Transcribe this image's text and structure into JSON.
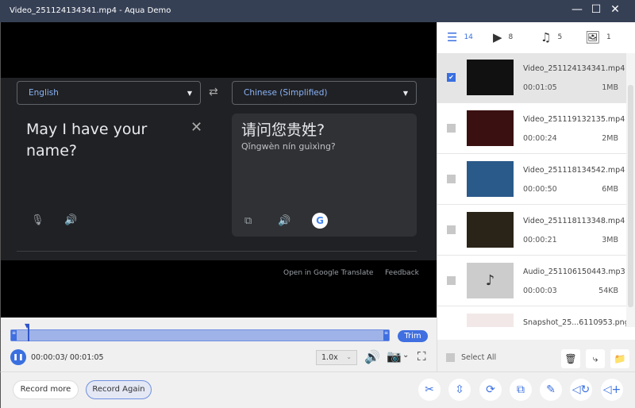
{
  "window": {
    "title": "Video_251124134341.mp4  -  Aqua Demo",
    "minimize": "—",
    "maximize": "☐",
    "close": "✕"
  },
  "translate": {
    "source_lang": "English",
    "target_lang": "Chinese (Simplified)",
    "source_text": "May I have your name?",
    "target_text": "请问您贵姓?",
    "romanization": "Qǐngwèn nín guìxìng?",
    "open_link": "Open in Google Translate",
    "feedback": "Feedback"
  },
  "player": {
    "trim": "Trim",
    "time": "00:00:03/ 00:01:05",
    "speed": "1.0x",
    "progress": 0.046
  },
  "buttons": {
    "record_more": "Record more",
    "record_again": "Record Again"
  },
  "tabs": [
    {
      "icon": "list-icon",
      "count": "14"
    },
    {
      "icon": "video-icon",
      "count": "8"
    },
    {
      "icon": "music-icon",
      "count": "5"
    },
    {
      "icon": "image-icon",
      "count": "1"
    }
  ],
  "files": [
    {
      "name": "Video_251124134341.mp4",
      "duration": "00:01:05",
      "size": "1MB",
      "checked": true
    },
    {
      "name": "Video_251119132135.mp4",
      "duration": "00:00:24",
      "size": "2MB"
    },
    {
      "name": "Video_251118134542.mp4",
      "duration": "00:00:50",
      "size": "6MB"
    },
    {
      "name": "Video_251118113348.mp4",
      "duration": "00:00:21",
      "size": "3MB"
    },
    {
      "name": "Audio_251106150443.mp3",
      "duration": "00:00:03",
      "size": "54KB"
    },
    {
      "name": "Snapshot_25...6110953.png",
      "duration": "",
      "size": ""
    }
  ],
  "select_all": "Select All"
}
